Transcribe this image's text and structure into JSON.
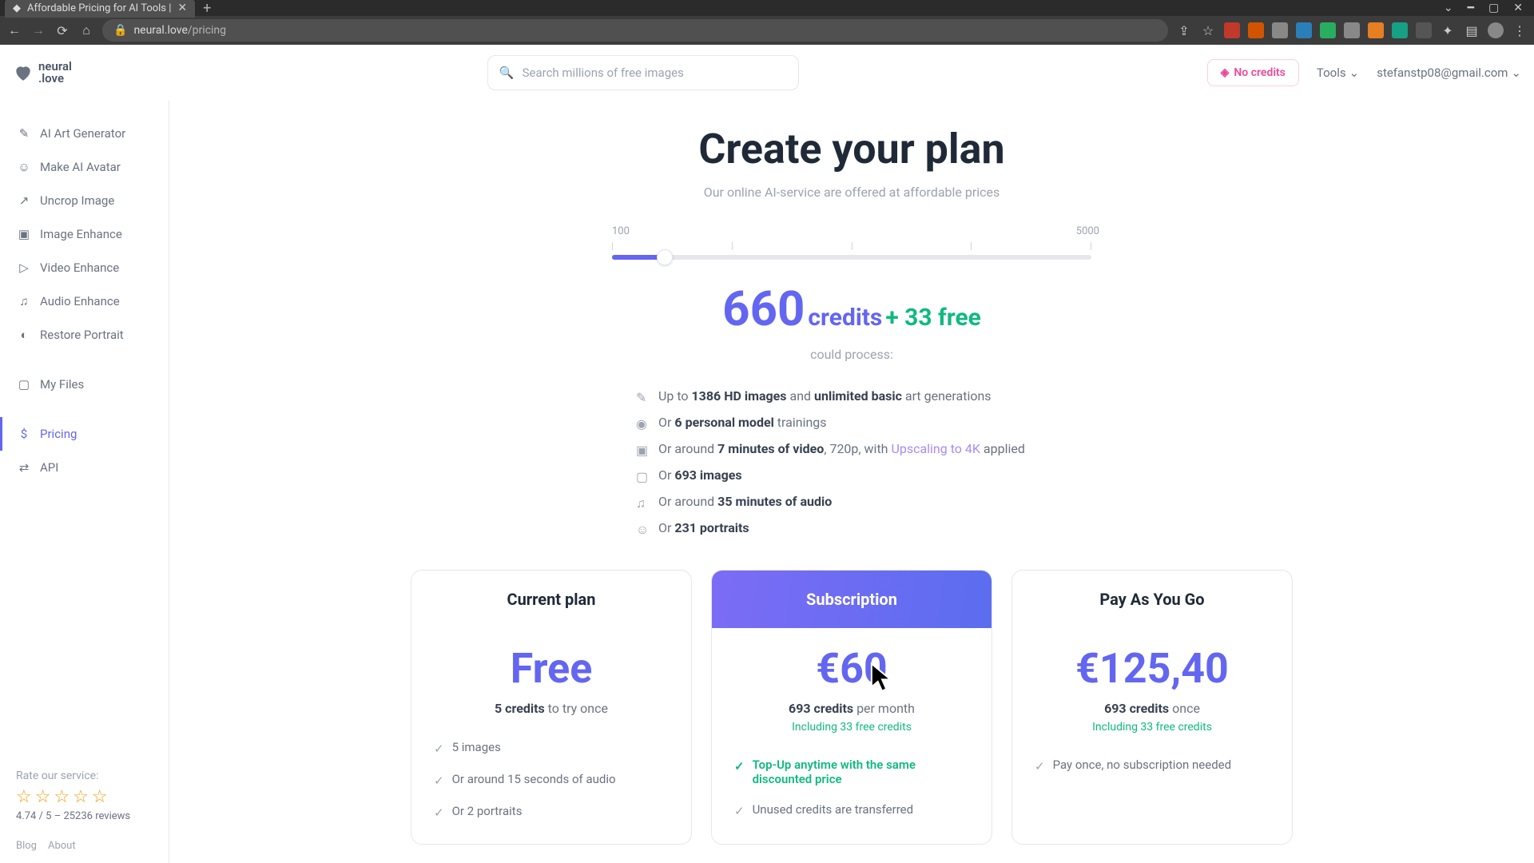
{
  "browser": {
    "tab_title": "Affordable Pricing for AI Tools |",
    "url_host": "neural.love",
    "url_path": "/pricing"
  },
  "topbar": {
    "logo_line1": "neural",
    "logo_line2": ".love",
    "search_placeholder": "Search millions of free images",
    "no_credits_label": "No credits",
    "tools_label": "Tools",
    "user_email": "stefanstp08@gmail.com"
  },
  "sidebar": {
    "items": [
      {
        "label": "AI Art Generator",
        "icon": "✎"
      },
      {
        "label": "Make AI Avatar",
        "icon": "☺"
      },
      {
        "label": "Uncrop Image",
        "icon": "↗"
      },
      {
        "label": "Image Enhance",
        "icon": "▣"
      },
      {
        "label": "Video Enhance",
        "icon": "▷"
      },
      {
        "label": "Audio Enhance",
        "icon": "♫"
      },
      {
        "label": "Restore Portrait",
        "icon": "◐"
      }
    ],
    "my_files": "My Files",
    "pricing": "Pricing",
    "api": "API",
    "rate_label": "Rate our service:",
    "rate_sub": "4.74 / 5 – 25236 reviews",
    "blog": "Blog",
    "about": "About"
  },
  "hero": {
    "title": "Create your plan",
    "subtitle": "Our online AI-service are offered at affordable prices"
  },
  "slider": {
    "min_label": "100",
    "max_label": "5000"
  },
  "credits": {
    "amount": "660",
    "label": "credits",
    "bonus": "+ 33 free",
    "could_process": "could process:"
  },
  "caps": [
    {
      "pre": "Up to ",
      "bold": "1386 HD images",
      "mid": " and ",
      "bold2": "unlimited basic",
      "post": " art generations"
    },
    {
      "pre": "Or ",
      "bold": "6 personal model",
      "post": " trainings"
    },
    {
      "pre": "Or around ",
      "bold": "7 minutes of video",
      "mid": ", 720p, with ",
      "purple": "Upscaling to 4K",
      "post": " applied"
    },
    {
      "pre": "Or ",
      "bold": "693 images"
    },
    {
      "pre": "Or around ",
      "bold": "35 minutes of audio"
    },
    {
      "pre": "Or ",
      "bold": "231 portraits"
    }
  ],
  "plans": {
    "current": {
      "title": "Current plan",
      "price": "Free",
      "sub_bold": "5 credits",
      "sub_rest": " to try once",
      "feats": [
        "5 images",
        "Or around 15 seconds of audio",
        "Or 2 portraits"
      ]
    },
    "subscription": {
      "title": "Subscription",
      "price": "€60",
      "sub_bold": "693 credits",
      "sub_rest": " per month",
      "including": "Including 33 free credits",
      "feat_green": "Top-Up anytime with the same discounted price",
      "feat2": "Unused credits are transferred"
    },
    "payg": {
      "title": "Pay As You Go",
      "price": "€125,40",
      "sub_bold": "693 credits",
      "sub_rest": " once",
      "including": "Including 33 free credits",
      "feat1": "Pay once, no subscription needed"
    }
  }
}
